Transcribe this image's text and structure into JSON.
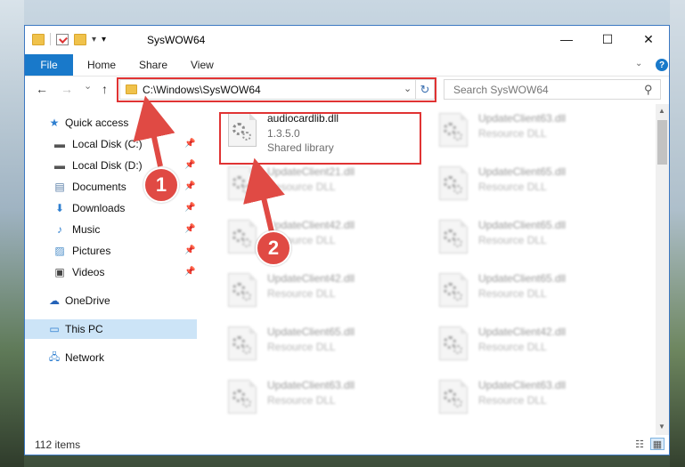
{
  "window": {
    "title": "SysWOW64",
    "minimize_glyph": "—",
    "maximize_glyph": "☐",
    "close_glyph": "✕"
  },
  "quick_access_toolbar": {
    "dropdown_glyph": "▾",
    "more_glyph": "▾"
  },
  "ribbon": {
    "tabs": [
      {
        "label": "File"
      },
      {
        "label": "Home"
      },
      {
        "label": "Share"
      },
      {
        "label": "View"
      }
    ],
    "collapse_glyph": "⌄",
    "help_glyph": "?"
  },
  "navigation": {
    "back_glyph": "←",
    "forward_glyph": "→",
    "recent_glyph": "⌄",
    "up_glyph": "↑",
    "address_path": "C:\\Windows\\SysWOW64",
    "address_dropdown_glyph": "⌄",
    "refresh_glyph": "↻",
    "search_placeholder": "Search SysWOW64",
    "search_glyph": "⚲"
  },
  "sidebar": {
    "items": [
      {
        "label": "Quick access",
        "icon": "star-icon",
        "glyph": "★",
        "pinned": false
      },
      {
        "label": "Local Disk (C:)",
        "icon": "drive-icon",
        "glyph": "▬",
        "pinned": true
      },
      {
        "label": "Local Disk (D:)",
        "icon": "drive-icon",
        "glyph": "▬",
        "pinned": true
      },
      {
        "label": "Documents",
        "icon": "documents-icon",
        "glyph": "▤",
        "pinned": true
      },
      {
        "label": "Downloads",
        "icon": "download-icon",
        "glyph": "⬇",
        "pinned": true
      },
      {
        "label": "Music",
        "icon": "music-icon",
        "glyph": "♪",
        "pinned": true
      },
      {
        "label": "Pictures",
        "icon": "pictures-icon",
        "glyph": "▨",
        "pinned": true
      },
      {
        "label": "Videos",
        "icon": "videos-icon",
        "glyph": "▣",
        "pinned": true
      },
      {
        "label": "OneDrive",
        "icon": "cloud-icon",
        "glyph": "☁",
        "pinned": false
      },
      {
        "label": "This PC",
        "icon": "computer-icon",
        "glyph": "▭",
        "pinned": false,
        "selected": true
      },
      {
        "label": "Network",
        "icon": "network-icon",
        "glyph": "🖧",
        "pinned": false
      }
    ],
    "pin_glyph": "📌"
  },
  "files": {
    "highlighted": {
      "name": "audiocardlib.dll",
      "version": "1.3.5.0",
      "type": "Shared library"
    },
    "items": [
      {
        "name": "UpdateClient63.dll",
        "type": "Resource DLL"
      },
      {
        "name": "UpdateClient21.dll",
        "type": "Resource DLL"
      },
      {
        "name": "UpdateClient65.dll",
        "type": "Resource DLL"
      },
      {
        "name": "UpdateClient42.dll",
        "type": "Resource DLL"
      },
      {
        "name": "UpdateClient65.dll",
        "type": "Resource DLL"
      },
      {
        "name": "UpdateClient42.dll",
        "type": "Resource DLL"
      },
      {
        "name": "UpdateClient65.dll",
        "type": "Resource DLL"
      },
      {
        "name": "UpdateClient65.dll",
        "type": "Resource DLL"
      },
      {
        "name": "UpdateClient42.dll",
        "type": "Resource DLL"
      },
      {
        "name": "UpdateClient63.dll",
        "type": "Resource DLL"
      },
      {
        "name": "UpdateClient63.dll",
        "type": "Resource DLL"
      }
    ]
  },
  "callouts": [
    {
      "label": "1"
    },
    {
      "label": "2"
    }
  ],
  "status": {
    "item_count": "112 items"
  },
  "scrollbar": {
    "up_glyph": "▲",
    "down_glyph": "▼"
  },
  "view_buttons": {
    "details_glyph": "☷",
    "tiles_glyph": "▦"
  },
  "colors": {
    "accent": "#1979ca",
    "annotation_red": "#e03333",
    "selection": "#cce4f7"
  }
}
